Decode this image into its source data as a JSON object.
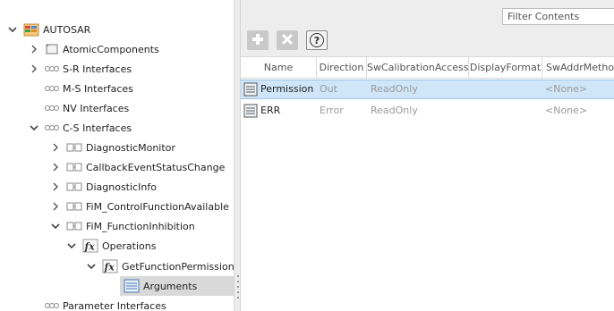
{
  "tree": {
    "items": [
      {
        "label": "AUTOSAR",
        "icon": "autosar-package-icon",
        "expanded": true
      },
      {
        "label": "AtomicComponents",
        "icon": "component-box-icon",
        "expanded": false
      },
      {
        "label": "S-R Interfaces",
        "icon": "interface-group-icon",
        "expanded": false
      },
      {
        "label": "M-S Interfaces",
        "icon": "interface-group-icon"
      },
      {
        "label": "NV Interfaces",
        "icon": "interface-group-icon"
      },
      {
        "label": "C-S Interfaces",
        "icon": "interface-group-icon",
        "expanded": true
      },
      {
        "label": "DiagnosticMonitor",
        "icon": "cs-interface-icon",
        "expanded": false
      },
      {
        "label": "CallbackEventStatusChange",
        "icon": "cs-interface-icon",
        "expanded": false
      },
      {
        "label": "DiagnosticInfo",
        "icon": "cs-interface-icon",
        "expanded": false
      },
      {
        "label": "FiM_ControlFunctionAvailable",
        "icon": "cs-interface-icon",
        "expanded": false
      },
      {
        "label": "FiM_FunctionInhibition",
        "icon": "cs-interface-icon",
        "expanded": true
      },
      {
        "label": "Operations",
        "icon": "function-fx-icon",
        "expanded": true
      },
      {
        "label": "GetFunctionPermission",
        "icon": "function-fx-icon",
        "expanded": true
      },
      {
        "label": "Arguments",
        "icon": "arguments-list-icon",
        "selected": true
      },
      {
        "label": "Parameter Interfaces",
        "icon": "interface-group-icon"
      }
    ]
  },
  "filter": {
    "placeholder": "Filter Contents"
  },
  "toolbar": {
    "add_icon": "add-icon",
    "delete_icon": "delete-icon",
    "help_icon": "help-icon",
    "help_glyph": "?"
  },
  "grid": {
    "columns": [
      "Name",
      "Direction",
      "SwCalibrationAccess",
      "DisplayFormat",
      "SwAddrMethod"
    ],
    "rows": [
      {
        "name": "Permission",
        "direction": "Out",
        "access": "ReadOnly",
        "format": "",
        "addr": "<None>",
        "selected": true
      },
      {
        "name": "ERR",
        "direction": "Error",
        "access": "ReadOnly",
        "format": "",
        "addr": "<None>",
        "selected": false
      }
    ]
  },
  "colors": {
    "selection_row": "#cfe5f8",
    "tree_selected": "#d9d9d9",
    "toolbar_bg": "#ededed"
  }
}
